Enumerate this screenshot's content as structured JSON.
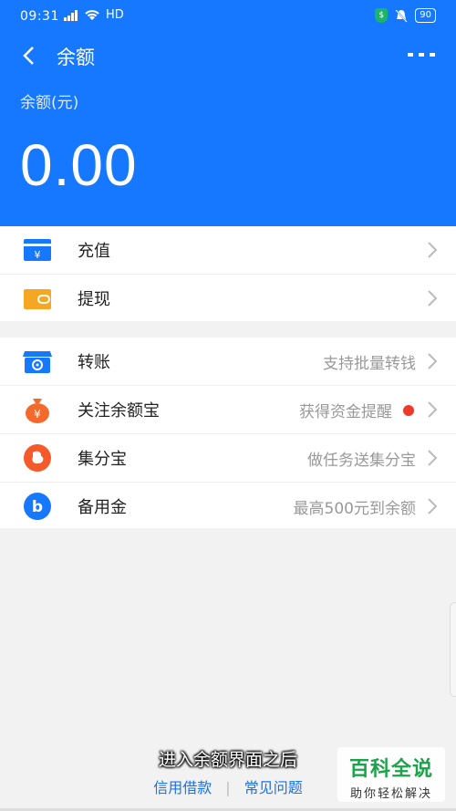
{
  "status_bar": {
    "time": "09:31",
    "network": "HD",
    "battery": "90"
  },
  "nav": {
    "title": "余额"
  },
  "balance": {
    "label": "余额(元)",
    "amount": "0.00"
  },
  "group1": [
    {
      "label": "充值",
      "icon": "recharge-card-icon"
    },
    {
      "label": "提现",
      "icon": "wallet-withdraw-icon"
    }
  ],
  "group2": [
    {
      "label": "转账",
      "hint": "支持批量转钱",
      "icon": "transfer-store-icon"
    },
    {
      "label": "关注余额宝",
      "hint": "获得资金提醒",
      "icon": "money-bag-icon",
      "badge_dot": true
    },
    {
      "label": "集分宝",
      "hint": "做任务送集分宝",
      "icon": "jifenbao-icon"
    },
    {
      "label": "备用金",
      "hint": "最高500元到余额",
      "icon": "reserve-fund-icon"
    }
  ],
  "caption": "进入余额界面之后",
  "footer": {
    "link1": "信用借款",
    "separator": "|",
    "link2": "常见问题"
  },
  "watermark": {
    "title": "百科全说",
    "subtitle": "助你轻松解决"
  },
  "colors": {
    "primary": "#1677ff",
    "accent_orange": "#f5a623",
    "badge_red": "#ee3a2b"
  }
}
